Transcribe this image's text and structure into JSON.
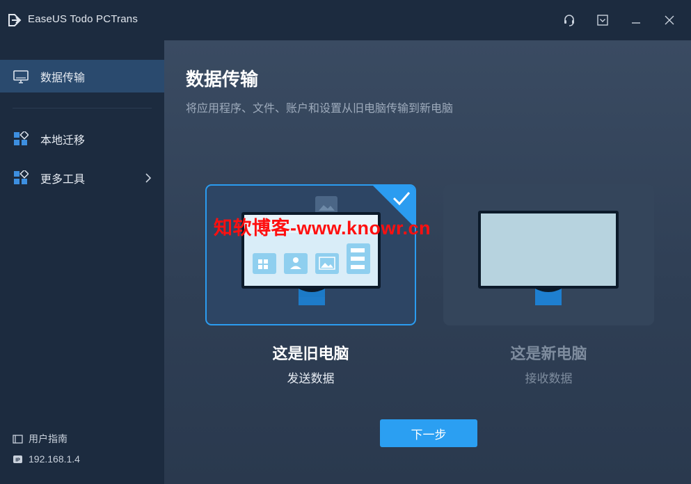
{
  "app": {
    "title": "EaseUS Todo PCTrans",
    "title_icon": "pctrans-logo-icon",
    "controls": [
      "support-headset-icon",
      "menu-dropdown-icon",
      "minimize-icon",
      "close-icon"
    ]
  },
  "sidebar": {
    "items": [
      {
        "label": "数据传输",
        "icon": "monitor-icon",
        "active": true
      },
      {
        "label": "本地迁移",
        "icon": "apps-grid-icon",
        "active": false
      },
      {
        "label": "更多工具",
        "icon": "apps-grid-icon",
        "active": false,
        "has_submenu": true
      }
    ],
    "footer": {
      "guide_label": "用户指南",
      "ip_label": "192.168.1.4"
    }
  },
  "main": {
    "title": "数据传输",
    "subtitle": "将应用程序、文件、账户和设置从旧电脑传输到新电脑",
    "cards": [
      {
        "title": "这是旧电脑",
        "subtitle": "发送数据",
        "selected": true
      },
      {
        "title": "这是新电脑",
        "subtitle": "接收数据",
        "selected": false
      }
    ],
    "next_button": "下一步"
  },
  "watermark": "知软博客-www.knowr.cn",
  "colors": {
    "accent": "#2b9ff2",
    "sidebar_bg": "#1c2b3f",
    "active_item": "#2a4a6e",
    "main_bg": "#34455b",
    "watermark": "#ff1010"
  }
}
